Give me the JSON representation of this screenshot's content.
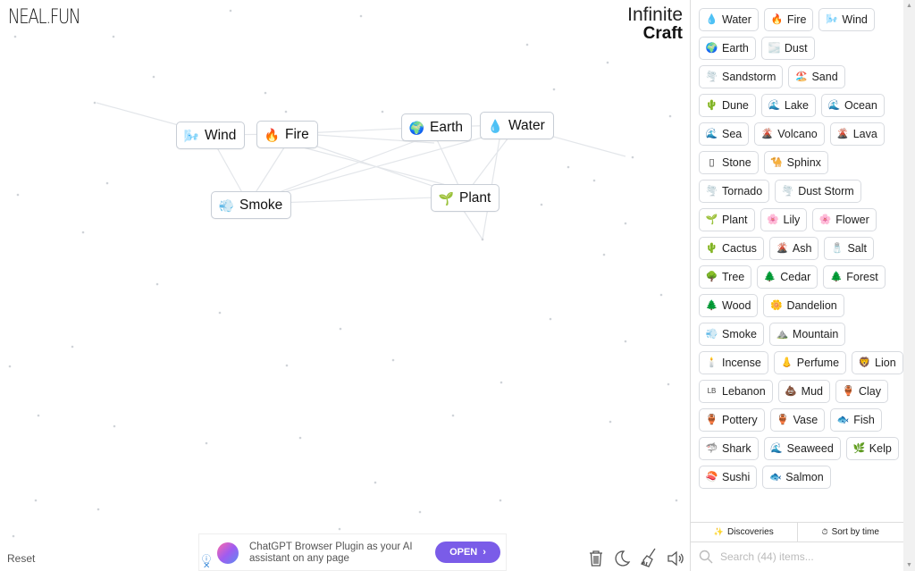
{
  "header": {
    "logo": "NEAL.FUN",
    "brand_line1": "Infinite",
    "brand_line2": "Craft"
  },
  "canvas": {
    "nodes": [
      {
        "label": "Wind",
        "icon": "wind-icon",
        "emoji": "🌬️"
      },
      {
        "label": "Fire",
        "icon": "fire-icon",
        "emoji": "🔥"
      },
      {
        "label": "Earth",
        "icon": "earth-icon",
        "emoji": "🌍"
      },
      {
        "label": "Water",
        "icon": "water-icon",
        "emoji": "💧"
      },
      {
        "label": "Smoke",
        "icon": "smoke-icon",
        "emoji": "💨"
      },
      {
        "label": "Plant",
        "icon": "plant-icon",
        "emoji": "🌱"
      }
    ],
    "reset_label": "Reset"
  },
  "ad": {
    "text": "ChatGPT Browser Plugin as your AI assistant on any page",
    "button_label": "OPEN",
    "button_arrow": "›",
    "info_glyph": "ⓘ",
    "close_glyph": "✕"
  },
  "toolbar": {
    "tools": [
      {
        "name": "trash-icon"
      },
      {
        "name": "moon-icon"
      },
      {
        "name": "broom-icon"
      },
      {
        "name": "sound-icon"
      }
    ]
  },
  "sidebar": {
    "items": [
      {
        "label": "Water",
        "icon": "water-icon",
        "emoji": "💧"
      },
      {
        "label": "Fire",
        "icon": "fire-icon",
        "emoji": "🔥"
      },
      {
        "label": "Wind",
        "icon": "wind-icon",
        "emoji": "🌬️"
      },
      {
        "label": "Earth",
        "icon": "earth-icon",
        "emoji": "🌍"
      },
      {
        "label": "Dust",
        "icon": "dust-icon",
        "emoji": "🌫️"
      },
      {
        "label": "Sandstorm",
        "icon": "tornado-icon",
        "emoji": "🌪️"
      },
      {
        "label": "Sand",
        "icon": "beach-icon",
        "emoji": "🏖️"
      },
      {
        "label": "Dune",
        "icon": "cactus-icon",
        "emoji": "🌵"
      },
      {
        "label": "Lake",
        "icon": "wave-icon",
        "emoji": "🌊"
      },
      {
        "label": "Ocean",
        "icon": "wave-icon",
        "emoji": "🌊"
      },
      {
        "label": "Sea",
        "icon": "wave-icon",
        "emoji": "🌊"
      },
      {
        "label": "Volcano",
        "icon": "volcano-icon",
        "emoji": "🌋"
      },
      {
        "label": "Lava",
        "icon": "volcano-icon",
        "emoji": "🌋"
      },
      {
        "label": "Stone",
        "icon": "rock-icon",
        "emoji": "▯"
      },
      {
        "label": "Sphinx",
        "icon": "camel-icon",
        "emoji": "🐪"
      },
      {
        "label": "Tornado",
        "icon": "tornado-icon",
        "emoji": "🌪️"
      },
      {
        "label": "Dust Storm",
        "icon": "tornado-icon",
        "emoji": "🌪️"
      },
      {
        "label": "Plant",
        "icon": "plant-icon",
        "emoji": "🌱"
      },
      {
        "label": "Lily",
        "icon": "flower-icon",
        "emoji": "🌸"
      },
      {
        "label": "Flower",
        "icon": "flower-icon",
        "emoji": "🌸"
      },
      {
        "label": "Cactus",
        "icon": "cactus-icon",
        "emoji": "🌵"
      },
      {
        "label": "Ash",
        "icon": "volcano-icon",
        "emoji": "🌋"
      },
      {
        "label": "Salt",
        "icon": "salt-icon",
        "emoji": "🧂"
      },
      {
        "label": "Tree",
        "icon": "tree-icon",
        "emoji": "🌳"
      },
      {
        "label": "Cedar",
        "icon": "evergreen-icon",
        "emoji": "🌲"
      },
      {
        "label": "Forest",
        "icon": "evergreen-icon",
        "emoji": "🌲"
      },
      {
        "label": "Wood",
        "icon": "evergreen-icon",
        "emoji": "🌲"
      },
      {
        "label": "Dandelion",
        "icon": "blossom-icon",
        "emoji": "🌼"
      },
      {
        "label": "Smoke",
        "icon": "smoke-icon",
        "emoji": "💨"
      },
      {
        "label": "Mountain",
        "icon": "mountain-icon",
        "emoji": "⛰️"
      },
      {
        "label": "Incense",
        "icon": "candle-icon",
        "emoji": "🕯️"
      },
      {
        "label": "Perfume",
        "icon": "nose-icon",
        "emoji": "👃"
      },
      {
        "label": "Lion",
        "icon": "lion-icon",
        "emoji": "🦁"
      },
      {
        "label": "Lebanon",
        "icon": "flag-lb-icon",
        "emoji": "LB"
      },
      {
        "label": "Mud",
        "icon": "mud-icon",
        "emoji": "💩"
      },
      {
        "label": "Clay",
        "icon": "pot-icon",
        "emoji": "🏺"
      },
      {
        "label": "Pottery",
        "icon": "pot-icon",
        "emoji": "🏺"
      },
      {
        "label": "Vase",
        "icon": "pot-icon",
        "emoji": "🏺"
      },
      {
        "label": "Fish",
        "icon": "fish-icon",
        "emoji": "🐟"
      },
      {
        "label": "Shark",
        "icon": "shark-icon",
        "emoji": "🦈"
      },
      {
        "label": "Seaweed",
        "icon": "wave-icon",
        "emoji": "🌊"
      },
      {
        "label": "Kelp",
        "icon": "leaf-icon",
        "emoji": "🌿"
      },
      {
        "label": "Sushi",
        "icon": "sushi-icon",
        "emoji": "🍣"
      },
      {
        "label": "Salmon",
        "icon": "fish-icon",
        "emoji": "🐟"
      }
    ],
    "tabs": [
      {
        "label": "Discoveries",
        "icon": "sparkle-icon",
        "glyph": "✨"
      },
      {
        "label": "Sort by time",
        "icon": "clock-icon",
        "glyph": "⏱"
      }
    ],
    "search": {
      "placeholder": "Search (44) items...",
      "value": ""
    }
  },
  "colors": {
    "node_border": "#c8ced6",
    "ad_button": "#7a5ce8",
    "scrollbar": "#f1f1f1"
  }
}
